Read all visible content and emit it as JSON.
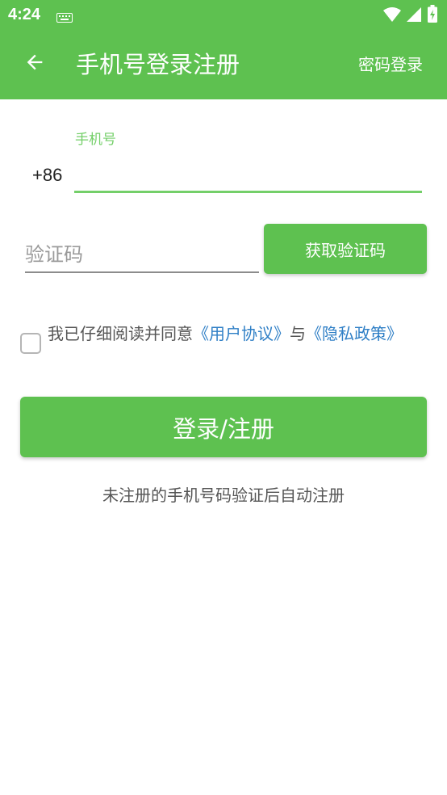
{
  "status_bar": {
    "time": "4:24",
    "icons": [
      "keyboard-icon",
      "wifi-icon",
      "signal-icon",
      "battery-icon"
    ]
  },
  "app_bar": {
    "back_icon": "arrow-left-icon",
    "title": "手机号登录注册",
    "password_login": "密码登录"
  },
  "form": {
    "phone_label": "手机号",
    "phone_prefix": "+86",
    "phone_value": "",
    "code_placeholder": "验证码",
    "get_code_label": "获取验证码"
  },
  "agreement": {
    "checked": false,
    "text": "我已仔细阅读并同意",
    "user_agreement": "《用户协议》",
    "and": "与",
    "privacy_policy": "《隐私政策》"
  },
  "login_label": "登录/注册",
  "hint": "未注册的手机号码验证后自动注册",
  "colors": {
    "primary": "#5ec150",
    "label_green": "#74cf69",
    "link": "#2f7fc6"
  }
}
